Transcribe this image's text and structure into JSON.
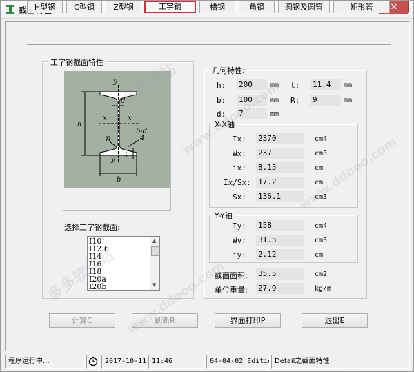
{
  "window": {
    "title": "截面特性",
    "close_label": "✕"
  },
  "tabs": [
    {
      "label": "H型钢"
    },
    {
      "label": "C型钢"
    },
    {
      "label": "Z型钢"
    },
    {
      "label": "工字钢"
    },
    {
      "label": "槽钢"
    },
    {
      "label": "角钢"
    },
    {
      "label": "圆钢及圆管"
    },
    {
      "label": "矩形管"
    }
  ],
  "left_panel": {
    "title": "工字钢截面特性",
    "select_label": "选择工字钢截面:",
    "list_items": [
      "I10",
      "I12.6",
      "I14",
      "I16",
      "I18",
      "I20a",
      "I20b"
    ],
    "diagram_labels": {
      "y_top": "y",
      "d": "d",
      "x_left": "x",
      "x_right": "x",
      "h": "h",
      "bd_top": "b-d",
      "bd_bottom": "4",
      "R": "R",
      "t": "t",
      "y_bottom": "y",
      "b": "b"
    }
  },
  "geometry": {
    "title": "几何特性:",
    "h_label": "h:",
    "h_value": "200",
    "h_unit": "mm",
    "t_label": "t:",
    "t_value": "11.4",
    "t_unit": "mm",
    "b_label": "b:",
    "b_value": "100",
    "b_unit": "mm",
    "R_label": "R:",
    "R_value": "9",
    "R_unit": "mm",
    "d_label": "d:",
    "d_value": "7",
    "d_unit": "mm"
  },
  "xx_axis": {
    "title": "X-X轴",
    "rows": [
      {
        "label": "Ix:",
        "value": "2370",
        "unit": "cm4"
      },
      {
        "label": "Wx:",
        "value": "237",
        "unit": "cm3"
      },
      {
        "label": "ix:",
        "value": "8.15",
        "unit": "cm"
      },
      {
        "label": "Ix/Sx:",
        "value": "17.2",
        "unit": "cm"
      },
      {
        "label": "Sx:",
        "value": "136.1",
        "unit": "cm3"
      }
    ]
  },
  "yy_axis": {
    "title": "Y-Y轴",
    "rows": [
      {
        "label": "Iy:",
        "value": "158",
        "unit": "cm4"
      },
      {
        "label": "Wy:",
        "value": "31.5",
        "unit": "cm3"
      },
      {
        "label": "iy:",
        "value": "2.12",
        "unit": "cm"
      }
    ]
  },
  "summary": {
    "area_label": "截面面积:",
    "area_value": "35.5",
    "area_unit": "cm2",
    "weight_label": "单位重量:",
    "weight_value": "27.9",
    "weight_unit": "kg/m"
  },
  "buttons": {
    "calc": "计算C",
    "refresh": "刷新R",
    "print": "界面打印P",
    "exit": "退出E"
  },
  "statusbar": {
    "status": "程序运行中...",
    "date": "2017-10-11",
    "time": "11:46",
    "version": "04-04-02 Edition",
    "module": "Detail之截面特性"
  },
  "watermarks": [
    "多多软件站",
    "www.ddooo.com"
  ],
  "colors": {
    "active_tab_border": "#d32f2f",
    "diagram_bg": "#a3b1a3",
    "close_button": "#c75050"
  }
}
